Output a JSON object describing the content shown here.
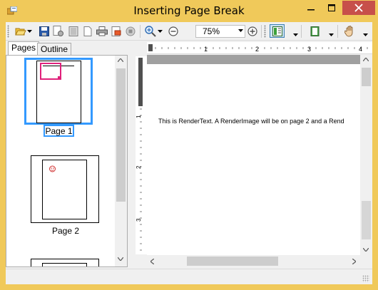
{
  "window": {
    "title": "Inserting Page Break",
    "accent": "#f0c95a",
    "close_color": "#c7504a",
    "controls": {
      "minimize": "minimize-icon",
      "maximize": "maximize-icon",
      "close": "close-icon"
    }
  },
  "toolbar": {
    "tools": [
      "open-icon",
      "save-icon",
      "page-setup-icon",
      "print-layout-icon",
      "page-icon",
      "print-icon",
      "export-icon",
      "stop-icon",
      "zoom-in-icon",
      "zoom-out-icon",
      "zoom-plus-icon",
      "thumbnails-icon",
      "single-page-icon",
      "hand-tool-icon"
    ],
    "zoom_value": "75%"
  },
  "left_panel": {
    "tabs": [
      {
        "label": "Pages",
        "active": true
      },
      {
        "label": "Outline",
        "active": false
      }
    ],
    "pages": [
      {
        "label": "Page 1",
        "selected": true
      },
      {
        "label": "Page 2",
        "selected": false
      }
    ],
    "selection_color": "#3399ff"
  },
  "ruler": {
    "h_labels": [
      "1",
      "2",
      "3",
      "4"
    ],
    "v_labels": [
      "1",
      "2",
      "3"
    ]
  },
  "preview": {
    "text": "This is RenderText. A RenderImage will be on page 2 and a Rend"
  }
}
